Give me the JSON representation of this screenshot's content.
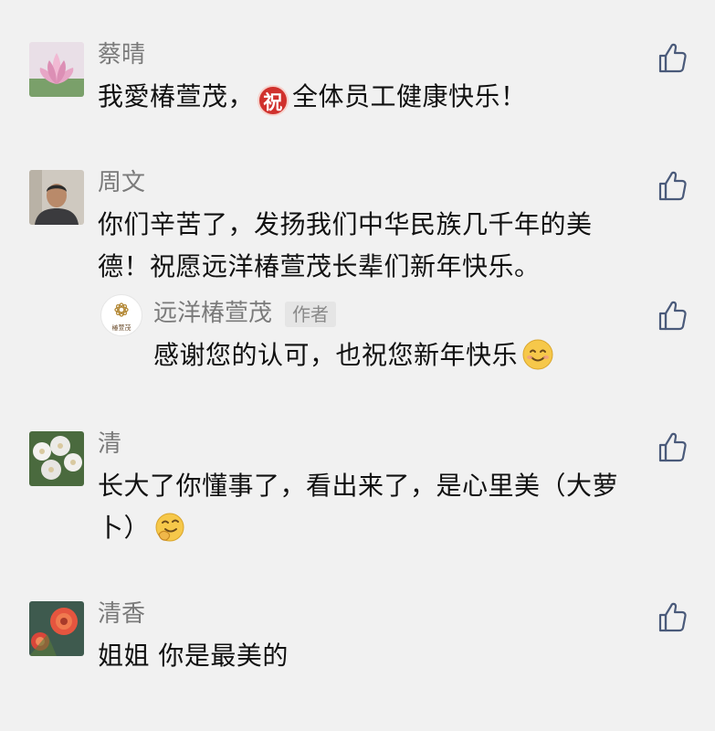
{
  "comments": [
    {
      "name": "蔡晴",
      "text_before": "我愛椿萱茂，",
      "sticker": "祝",
      "text_after": "全体员工健康快乐！",
      "avatar": "lotus-avatar"
    },
    {
      "name": "周文",
      "line1": "你们辛苦了，发扬我们中华民族几千年的美",
      "line2": "德！祝愿远洋椿萱茂长辈们新年快乐。",
      "avatar": "man-avatar",
      "reply": {
        "name": "远洋椿萱茂",
        "badge": "作者",
        "logo_text": "椿萱茂",
        "text": "感谢您的认可，也祝您新年快乐",
        "emoji": "smile-emoji"
      }
    },
    {
      "name": "清",
      "line1": "长大了你懂事了，看出来了，是心里美（大萝",
      "line2": "卜）",
      "emoji": "giggle-emoji",
      "avatar": "flowers-avatar"
    },
    {
      "name": "清香",
      "text": "姐姐 你是最美的",
      "avatar": "red-flower-avatar"
    }
  ],
  "colors": {
    "background": "#f1f1f1",
    "name": "#7a7a7a",
    "text": "#111111",
    "like_icon": "#4a5a7a"
  }
}
